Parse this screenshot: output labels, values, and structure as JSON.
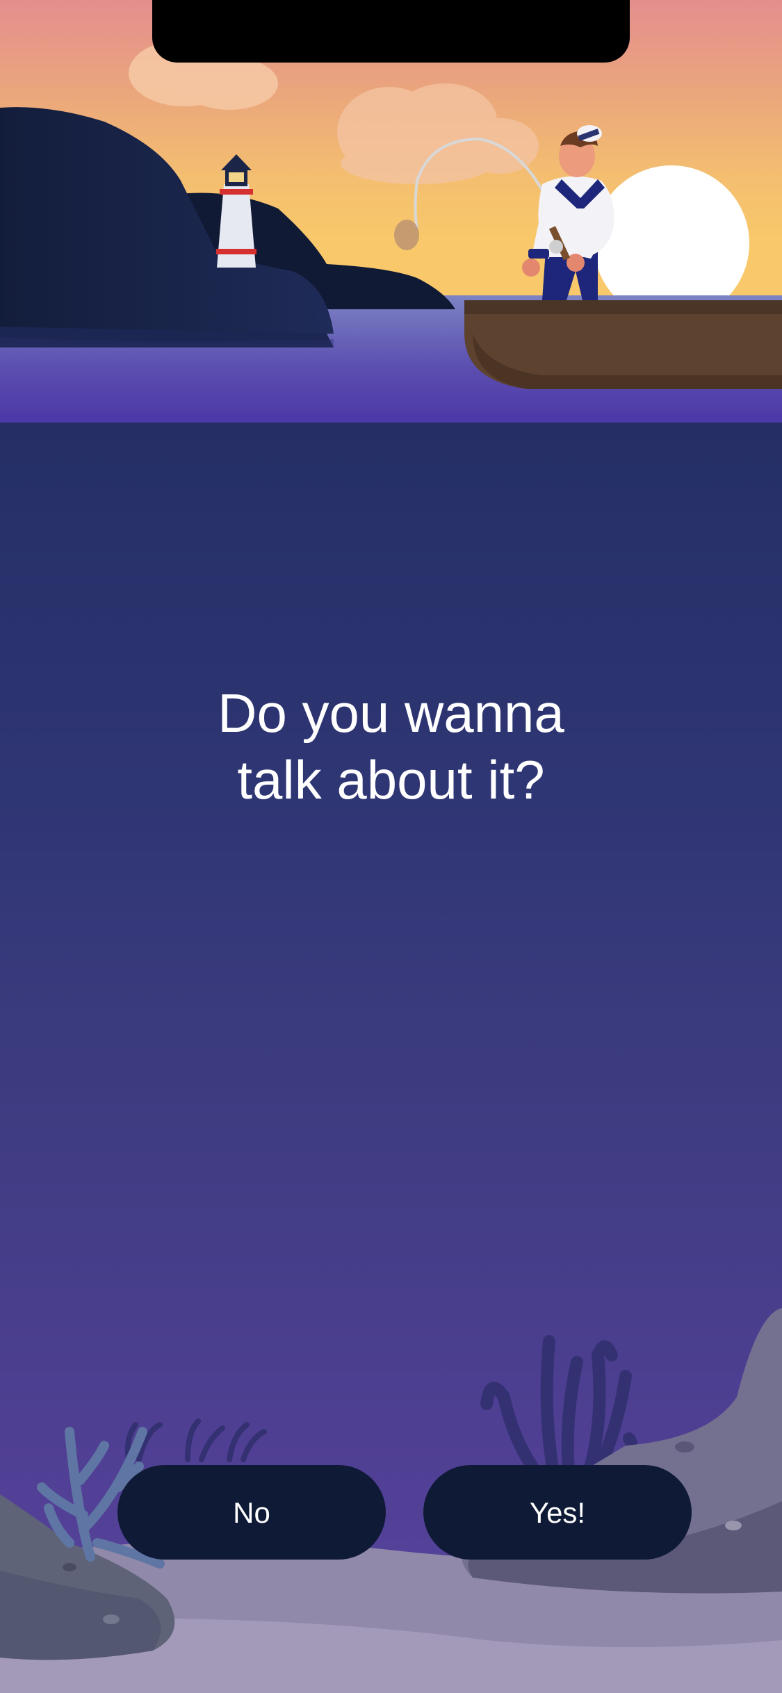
{
  "prompt": {
    "line1": "Do you wanna",
    "line2": "talk about it?"
  },
  "buttons": {
    "no_label": "No",
    "yes_label": "Yes!"
  },
  "colors": {
    "button_bg": "#0f1a36",
    "deep_water": "#2a3470",
    "surface_water": "#5a4fb0",
    "sky_top": "#e48e8e",
    "sky_bottom": "#f8c86a"
  },
  "icons": {
    "hero": "sailor-fishing-illustration",
    "landmark": "lighthouse-icon",
    "seabed": "coral-reef-illustration"
  }
}
